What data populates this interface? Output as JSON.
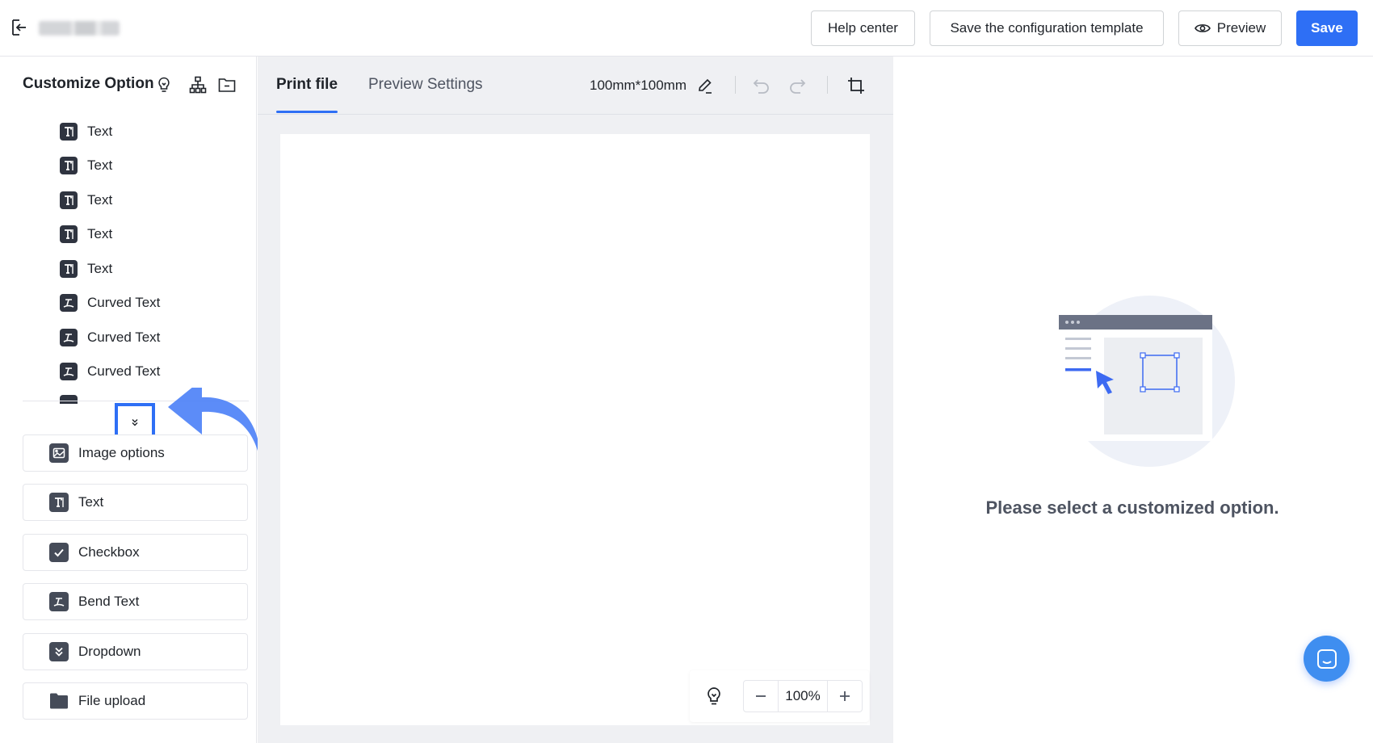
{
  "header": {
    "help_label": "Help center",
    "template_label": "Save the configuration template",
    "preview_label": "Preview",
    "save_label": "Save"
  },
  "left_panel": {
    "title": "Customize Option",
    "layers": [
      {
        "label": "Text",
        "icon": "text-icon"
      },
      {
        "label": "Text",
        "icon": "text-icon"
      },
      {
        "label": "Text",
        "icon": "text-icon"
      },
      {
        "label": "Text",
        "icon": "text-icon"
      },
      {
        "label": "Text",
        "icon": "text-icon"
      },
      {
        "label": "Curved Text",
        "icon": "curved-text-icon"
      },
      {
        "label": "Curved Text",
        "icon": "curved-text-icon"
      },
      {
        "label": "Curved Text",
        "icon": "curved-text-icon"
      }
    ],
    "options": [
      {
        "label": "Image options",
        "icon": "image-icon"
      },
      {
        "label": "Text",
        "icon": "text-icon"
      },
      {
        "label": "Checkbox",
        "icon": "checkbox-icon"
      },
      {
        "label": "Bend Text",
        "icon": "bend-text-icon"
      },
      {
        "label": "Dropdown",
        "icon": "dropdown-icon"
      },
      {
        "label": "File upload",
        "icon": "folder-icon"
      }
    ]
  },
  "canvas": {
    "tabs": [
      {
        "label": "Print file",
        "active": true
      },
      {
        "label": "Preview Settings",
        "active": false
      }
    ],
    "size": "100mm*100mm",
    "zoom": "100%"
  },
  "right_panel": {
    "empty_message": "Please select a customized option."
  },
  "colors": {
    "accent": "#2e6ff5",
    "chat": "#3f8ef0"
  }
}
